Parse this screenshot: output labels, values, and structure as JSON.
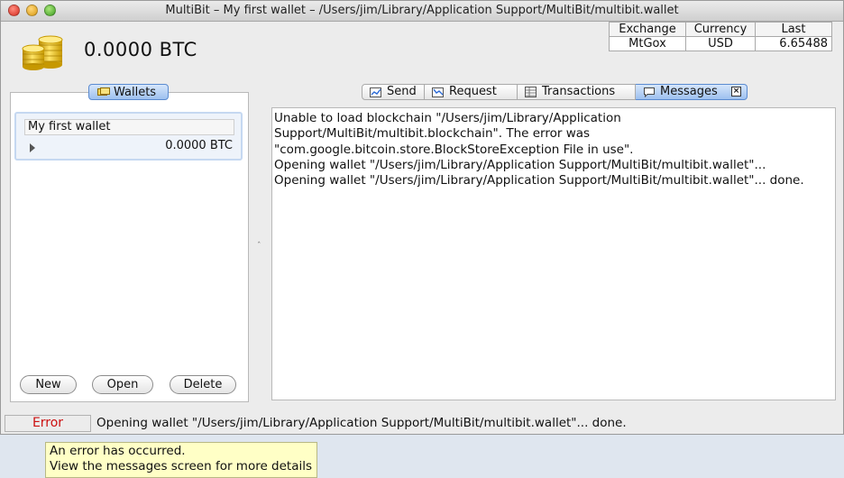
{
  "window": {
    "title": "MultiBit – My first wallet – /Users/jim/Library/Application Support/MultiBit/multibit.wallet"
  },
  "balance": {
    "amount": "0.0000 BTC",
    "icon": "bitcoin-coins-icon"
  },
  "ticker": {
    "headers": [
      "Exchange",
      "Currency",
      "Last"
    ],
    "row": [
      "MtGox",
      "USD",
      "6.65488"
    ]
  },
  "wallets": {
    "tab_label": "Wallets",
    "items": [
      {
        "name": "My first wallet",
        "balance": "0.0000 BTC"
      }
    ],
    "buttons": {
      "new": "New",
      "open": "Open",
      "delete": "Delete"
    }
  },
  "tabs": [
    {
      "label": "Send",
      "icon": "send-icon"
    },
    {
      "label": "Request",
      "icon": "request-icon"
    },
    {
      "label": "Transactions",
      "icon": "transactions-icon"
    },
    {
      "label": "Messages",
      "icon": "messages-icon",
      "selected": true
    }
  ],
  "messages": [
    "Unable to load blockchain \"/Users/jim/Library/Application",
    "Support/MultiBit/multibit.blockchain\". The error was",
    "\"com.google.bitcoin.store.BlockStoreException File in use\".",
    "Opening wallet \"/Users/jim/Library/Application Support/MultiBit/multibit.wallet\"...",
    "Opening wallet \"/Users/jim/Library/Application Support/MultiBit/multibit.wallet\"... done."
  ],
  "status": {
    "label": "Error",
    "message": "Opening wallet \"/Users/jim/Library/Application Support/MultiBit/multibit.wallet\"... done."
  },
  "tooltip": {
    "line1": "An error has occurred.",
    "line2": "View the messages screen for more details"
  },
  "colors": {
    "error": "#cc1010",
    "selected_tab": "#9dc0ef",
    "tooltip_bg": "#ffffc6"
  }
}
